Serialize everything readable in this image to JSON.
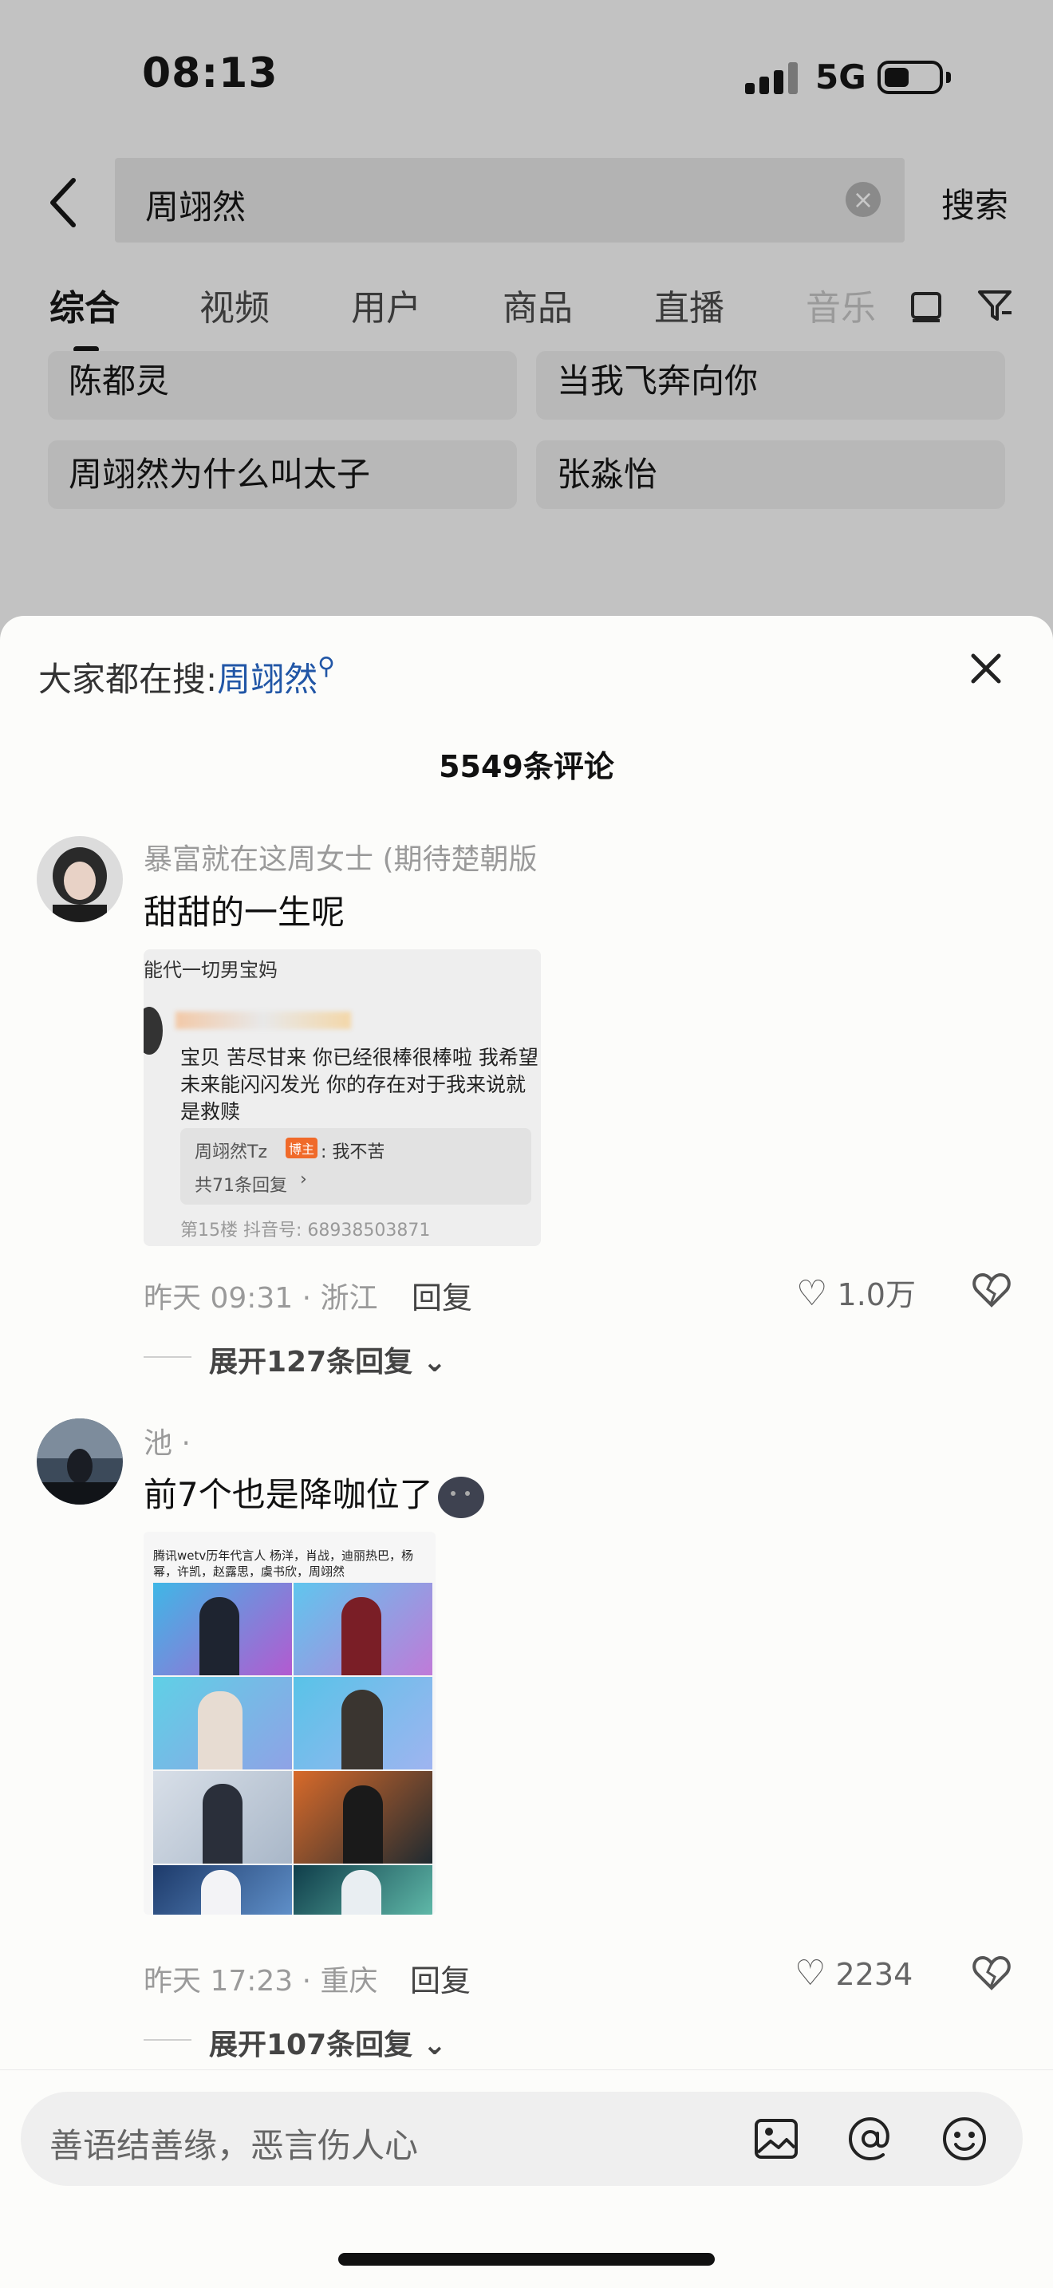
{
  "status_bar": {
    "time": "08:13",
    "network": "5G"
  },
  "search": {
    "query": "周翊然",
    "submit_label": "搜索"
  },
  "tabs": [
    {
      "label": "综合",
      "active": true
    },
    {
      "label": "视频"
    },
    {
      "label": "用户"
    },
    {
      "label": "商品"
    },
    {
      "label": "直播"
    },
    {
      "label": "音乐"
    }
  ],
  "suggestions": [
    "陈都灵",
    "当我飞奔向你",
    "周翊然为什么叫太子",
    "张淼怡"
  ],
  "sheet": {
    "hot_search_prefix": "大家都在搜:",
    "hot_search_keyword": "周翊然",
    "comment_count": "5549条评论"
  },
  "comments": [
    {
      "username": "暴富就在这周女士 (期待楚朝版",
      "text": "甜甜的一生呢",
      "image": {
        "line1": "能代一切男宝妈",
        "line2": "宝贝 苦尽甘来 你已经很棒很棒啦 我希望",
        "line3": "未来能闪闪发光 你的存在对于我来说就",
        "line4": "是救赎",
        "quote_user": "周翊然Tz",
        "quote_tag": "博主",
        "quote_text": ": 我不苦",
        "reply_count": "共71条回复",
        "footer": "第15楼  抖音号: 68938503871"
      },
      "time_location": "昨天 09:31 · 浙江",
      "reply_label": "回复",
      "likes": "1.0万",
      "expand": "展开127条回复"
    },
    {
      "username": "池 ·",
      "text": "前7个也是降咖位了",
      "image": {
        "caption": "腾讯wetv历年代言人 杨洋，肖战，迪丽热巴，杨幂，许凯，赵露思，虞书欣，周翊然"
      },
      "time_location": "昨天 17:23 · 重庆",
      "reply_label": "回复",
      "likes": "2234",
      "expand": "展开107条回复"
    }
  ],
  "input": {
    "placeholder": "善语结善缘，恶言伤人心"
  },
  "colors": {
    "keyword_blue": "#2156a6",
    "sheet_bg": "#fcfcfa"
  }
}
